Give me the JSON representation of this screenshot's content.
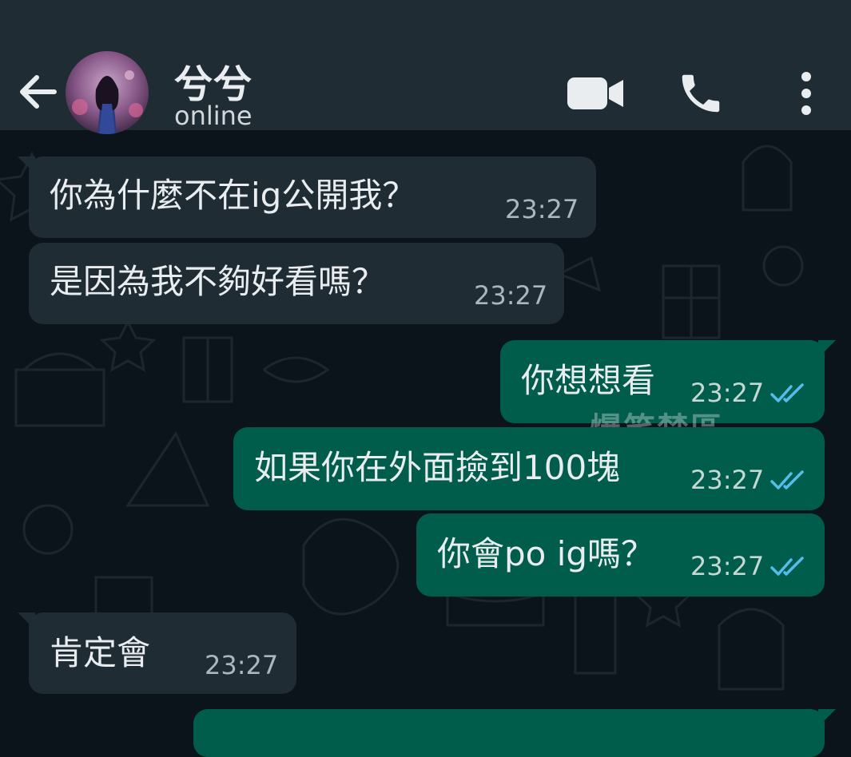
{
  "header": {
    "contact_name": "兮兮",
    "status": "online",
    "back_icon": "arrow-left-icon",
    "video_icon": "video-camera-icon",
    "call_icon": "phone-icon",
    "more_icon": "more-vertical-icon"
  },
  "messages": [
    {
      "direction": "incoming",
      "text": "你為什麼不在ig公開我？",
      "time": "23:27"
    },
    {
      "direction": "incoming",
      "text": "是因為我不夠好看嗎？",
      "time": "23:27"
    },
    {
      "direction": "outgoing",
      "text": "你想想看",
      "time": "23:27",
      "status": "read"
    },
    {
      "direction": "outgoing",
      "text": "如果你在外面撿到100塊",
      "time": "23:27",
      "status": "read"
    },
    {
      "direction": "outgoing",
      "text": "你會po ig嗎？",
      "time": "23:27",
      "status": "read"
    },
    {
      "direction": "incoming",
      "text": "肯定會",
      "time": "23:27"
    }
  ],
  "watermark": "爆笑禁區",
  "colors": {
    "header_bg": "#1f2c34",
    "chat_bg": "#0b141a",
    "incoming_bubble": "#1f2c33",
    "outgoing_bubble": "#005c4b",
    "read_ticks": "#53bdeb"
  }
}
